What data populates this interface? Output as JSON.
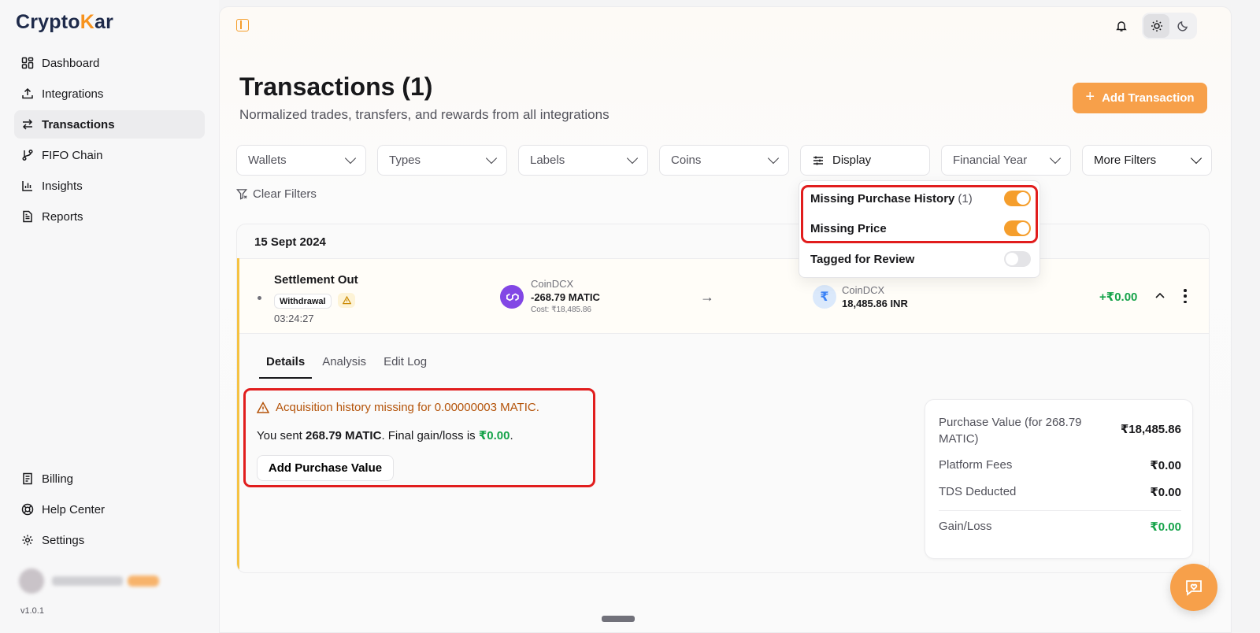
{
  "brand": {
    "name_prefix": "Crypto",
    "name_k": "K",
    "name_suffix": "ar"
  },
  "sidebar": {
    "items": [
      {
        "label": "Dashboard",
        "icon": "dashboard-grid-icon"
      },
      {
        "label": "Integrations",
        "icon": "upload-icon"
      },
      {
        "label": "Transactions",
        "icon": "arrows-swap-icon",
        "active": true
      },
      {
        "label": "FIFO Chain",
        "icon": "git-branch-icon"
      },
      {
        "label": "Insights",
        "icon": "bar-chart-icon"
      },
      {
        "label": "Reports",
        "icon": "document-icon"
      }
    ],
    "bottom_items": [
      {
        "label": "Billing",
        "icon": "receipt-icon"
      },
      {
        "label": "Help Center",
        "icon": "lifebuoy-icon"
      },
      {
        "label": "Settings",
        "icon": "gear-icon"
      }
    ],
    "version": "v1.0.1"
  },
  "header": {
    "title": "Transactions (1)",
    "subtitle": "Normalized trades, transfers, and rewards from all integrations",
    "add_button": "Add Transaction"
  },
  "filters": {
    "wallets": "Wallets",
    "types": "Types",
    "labels": "Labels",
    "coins": "Coins",
    "display": "Display",
    "financial_year": "Financial Year",
    "more_filters": "More Filters",
    "clear": "Clear Filters"
  },
  "display_menu": {
    "missing_purchase_history": "Missing Purchase History",
    "missing_purchase_history_count": "(1)",
    "missing_price": "Missing Price",
    "tagged_for_review": "Tagged for Review",
    "toggles": {
      "missing_purchase_history": true,
      "missing_price": true,
      "tagged_for_review": false
    }
  },
  "transaction": {
    "date": "15 Sept 2024",
    "title": "Settlement Out",
    "type_badge": "Withdrawal",
    "time": "03:24:27",
    "from_source": "CoinDCX",
    "from_amount": "-268.79 MATIC",
    "from_cost": "Cost: ₹18,485.86",
    "to_source": "CoinDCX",
    "to_amount": "18,485.86 INR",
    "inr_symbol": "₹",
    "gain": "+₹0.00"
  },
  "details": {
    "tabs": [
      "Details",
      "Analysis",
      "Edit Log"
    ],
    "alert_message": "Acquisition history missing for 0.00000003 MATIC.",
    "sent_prefix": "You sent ",
    "sent_amount": "268.79 MATIC",
    "sent_middle": ". Final gain/loss is ",
    "sent_gain": "₹0.00",
    "sent_suffix": ".",
    "add_purchase_button": "Add Purchase Value",
    "summary": {
      "purchase_label_1": "Purchase Value (for 268.79",
      "purchase_label_2": "MATIC)",
      "purchase_value": "₹18,485.86",
      "fees_label": "Platform Fees",
      "fees_value": "₹0.00",
      "tds_label": "TDS Deducted",
      "tds_value": "₹0.00",
      "gain_label": "Gain/Loss",
      "gain_value": "₹0.00"
    }
  },
  "colors": {
    "accent": "#f7a04a",
    "positive": "#16a34a",
    "warning": "#b45309",
    "highlight_border": "#e11d1d"
  }
}
